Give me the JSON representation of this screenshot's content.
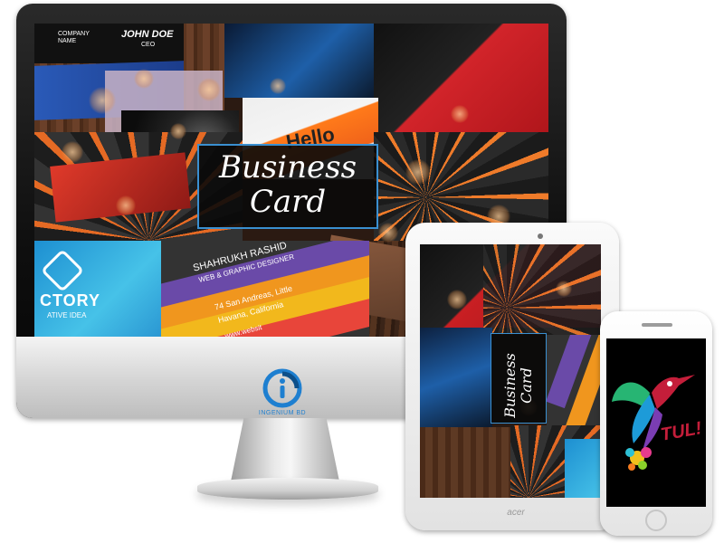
{
  "monitor": {
    "screen": {
      "title_line1": "Business",
      "title_line2": "Card",
      "overlay_texts": {
        "company_name": "COMPANY\nNAME",
        "john_doe": "JOHN DOE",
        "ceo": "CEO",
        "hello": "Hello",
        "shahrukh": "SHAHRUKH RASHID",
        "designer": "WEB & GRAPHIC DESIGNER",
        "address1": "74 San Andreas, Little",
        "address2": "Havana, California",
        "website": "www.websit",
        "factory": "CTORY",
        "factory_sub": "ATIVE IDEA"
      }
    },
    "logo": {
      "name": "INGENIUM BD"
    }
  },
  "tablet": {
    "brand": "acer",
    "screen": {
      "title_line1": "Business",
      "title_line2": "Card"
    }
  },
  "phone": {
    "screen": {
      "logo_text": "TUL!"
    }
  },
  "colors": {
    "accent_blue": "#1e7fd0",
    "orange": "#ef7b2a",
    "red": "#d2242a",
    "purple": "#6a4aa8"
  }
}
